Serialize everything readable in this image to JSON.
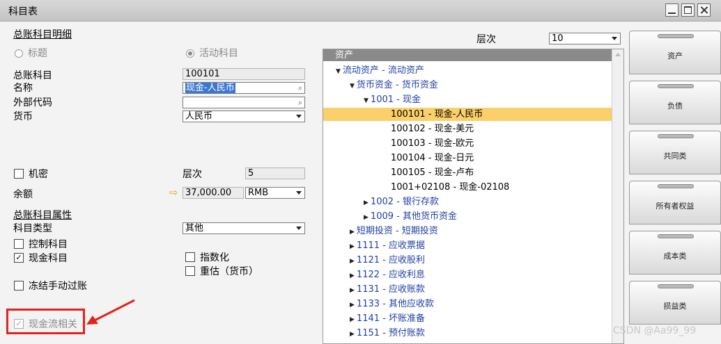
{
  "window": {
    "title": "科目表"
  },
  "left": {
    "section1": "总账科目明细",
    "radio_title": "标题",
    "radio_active": "活动科目",
    "gl_account_label": "总账科目",
    "gl_account_value": "100101",
    "name_label": "名称",
    "name_value": "现金-人民币",
    "ext_code_label": "外部代码",
    "ext_code_value": "",
    "currency_label": "货币",
    "currency_value": "人民币",
    "confidential_label": "机密",
    "level_label": "层次",
    "level_value": "5",
    "balance_label": "余额",
    "balance_value": "37,000.00",
    "balance_currency": "RMB",
    "section2": "总账科目属性",
    "acct_type_label": "科目类型",
    "acct_type_value": "其他",
    "control_label": "控制科目",
    "cash_label": "现金科目",
    "indexed_label": "指数化",
    "reval_label": "重估（货币）",
    "freeze_label": "冻结手动过账",
    "cashflow_label": "现金流相关"
  },
  "tree_header": {
    "level_label": "层次",
    "level_value": "10"
  },
  "tree": {
    "root": "资产",
    "nodes": [
      {
        "text": "流动资产 - 流动资产",
        "indent": 1,
        "expanded": true,
        "leaf": false
      },
      {
        "text": "货币资金 - 货币资金",
        "indent": 2,
        "expanded": true,
        "leaf": false
      },
      {
        "text": "1001 - 现金",
        "indent": 3,
        "expanded": true,
        "leaf": false
      },
      {
        "text": "100101 - 现金-人民币",
        "indent": 4,
        "leaf": true,
        "selected": true
      },
      {
        "text": "100102 - 现金-美元",
        "indent": 4,
        "leaf": true
      },
      {
        "text": "100103 - 现金-欧元",
        "indent": 4,
        "leaf": true
      },
      {
        "text": "100104 - 现金-日元",
        "indent": 4,
        "leaf": true
      },
      {
        "text": "100105 - 现金-卢布",
        "indent": 4,
        "leaf": true
      },
      {
        "text": "1001+02108 - 现金-02108",
        "indent": 4,
        "leaf": true
      },
      {
        "text": "1002 - 银行存款",
        "indent": 3,
        "expanded": false,
        "leaf": false
      },
      {
        "text": "1009 - 其他货币资金",
        "indent": 3,
        "expanded": false,
        "leaf": false
      },
      {
        "text": "短期投资 - 短期投资",
        "indent": 2,
        "expanded": false,
        "leaf": false
      },
      {
        "text": "1111 - 应收票据",
        "indent": 2,
        "expanded": false,
        "leaf": false
      },
      {
        "text": "1121 - 应收股利",
        "indent": 2,
        "expanded": false,
        "leaf": false
      },
      {
        "text": "1122 - 应收利息",
        "indent": 2,
        "expanded": false,
        "leaf": false
      },
      {
        "text": "1131 - 应收账款",
        "indent": 2,
        "expanded": false,
        "leaf": false
      },
      {
        "text": "1133 - 其他应收款",
        "indent": 2,
        "expanded": false,
        "leaf": false
      },
      {
        "text": "1141 - 坏账准备",
        "indent": 2,
        "expanded": false,
        "leaf": false
      },
      {
        "text": "1151 - 预付账款",
        "indent": 2,
        "expanded": false,
        "leaf": false
      }
    ]
  },
  "drawers": [
    "资产",
    "负债",
    "共同类",
    "所有者权益",
    "成本类",
    "损益类"
  ],
  "watermark": "CSDN @Aa99_99",
  "colors": {
    "selected_row": "#fbcf69",
    "callout": "#e0241b",
    "tree_link": "#1f3fa6"
  }
}
